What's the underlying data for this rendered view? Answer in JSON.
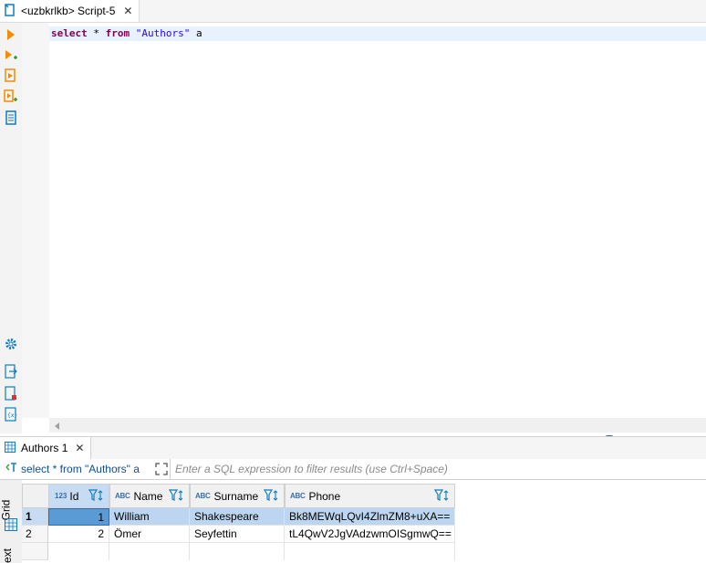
{
  "editor_tab": {
    "label": "<uzbkrlkb> Script-5",
    "close": "✕"
  },
  "editor": {
    "sql": {
      "kw1": "select",
      "rest1": " * ",
      "kw2": "from",
      "sp": " ",
      "table": "\"Authors\"",
      "alias": " a"
    }
  },
  "results_tab": {
    "label": "Authors 1",
    "close": "✕"
  },
  "filter_bar": {
    "query_label": "select * from \"Authors\" a",
    "placeholder": "Enter a SQL expression to filter results (use Ctrl+Space)"
  },
  "side_panel": {
    "grid": "Grid",
    "text": "ext"
  },
  "grid": {
    "columns": [
      {
        "type": "123",
        "name": "Id"
      },
      {
        "type": "ABC",
        "name": "Name"
      },
      {
        "type": "ABC",
        "name": "Surname"
      },
      {
        "type": "ABC",
        "name": "Phone"
      }
    ],
    "rows": [
      {
        "num": "1",
        "id": "1",
        "name": "William",
        "surname": "Shakespeare",
        "phone": "Bk8MEWqLQvI4ZlmZM8+uXA=="
      },
      {
        "num": "2",
        "id": "2",
        "name": "Ömer",
        "surname": "Seyfettin",
        "phone": "tL4QwV2JgVAdzwmOISgmwQ=="
      }
    ]
  },
  "colors": {
    "accent": "#0f7dc2",
    "selection": "#bcd6f1",
    "keyword": "#7f0055",
    "string": "#2a00ff"
  }
}
